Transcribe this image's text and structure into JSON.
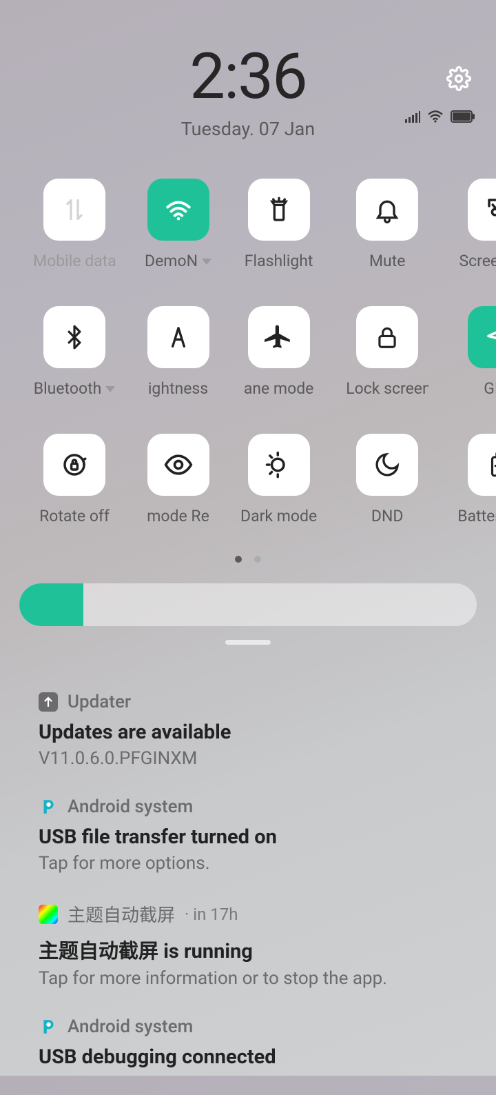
{
  "header": {
    "time": "2:36",
    "date": "Tuesday. 07 Jan"
  },
  "tiles": [
    {
      "label": "Mobile data",
      "icon": "mobile-data",
      "active": false,
      "dim": true
    },
    {
      "label": "DemoN",
      "icon": "wifi",
      "active": true,
      "arrow": true
    },
    {
      "label": "Flashlight",
      "icon": "flashlight",
      "active": false
    },
    {
      "label": "Mute",
      "icon": "bell",
      "active": false
    },
    {
      "label": "Screenshot",
      "icon": "screenshot",
      "active": false
    },
    {
      "label": "Bluetooth",
      "icon": "bluetooth",
      "active": false,
      "arrow": true
    },
    {
      "label": "ightness",
      "icon": "auto-brightness",
      "active": false
    },
    {
      "label": "ane mode",
      "icon": "airplane",
      "active": false
    },
    {
      "label": "Lock screen",
      "icon": "lock",
      "active": false
    },
    {
      "label": "GPS",
      "icon": "gps",
      "active": true
    },
    {
      "label": "Rotate off",
      "icon": "rotate-lock",
      "active": false
    },
    {
      "label": "mode     Re",
      "icon": "eye",
      "active": false
    },
    {
      "label": "Dark mode",
      "icon": "dark-mode",
      "active": false
    },
    {
      "label": "DND",
      "icon": "moon",
      "active": false
    },
    {
      "label": "Battery saver",
      "icon": "battery-saver",
      "active": false
    }
  ],
  "brightness_percent": 14,
  "notifications": [
    {
      "app": "Updater",
      "icon": "updater",
      "title": "Updates are available",
      "body": "V11.0.6.0.PFGINXM"
    },
    {
      "app": "Android system",
      "icon": "p",
      "title": "USB file transfer turned on",
      "body": "Tap for more options."
    },
    {
      "app": "主题自动截屏",
      "icon": "theme",
      "meta": "· in 17h",
      "title": "主题自动截屏 is running",
      "body": "Tap for more information or to stop the app."
    },
    {
      "app": "Android system",
      "icon": "p",
      "title": "USB debugging connected",
      "body": ""
    }
  ]
}
